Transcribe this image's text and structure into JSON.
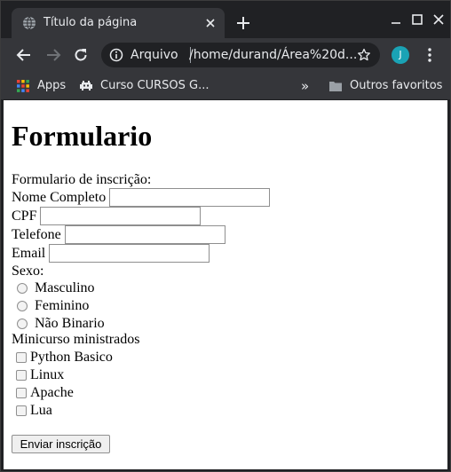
{
  "browser": {
    "tab_title": "Título da página",
    "omnibox_scheme": "Arquivo",
    "omnibox_url": "/home/durand/Área%20d...",
    "avatar_letter": "J",
    "bookmarks": {
      "apps_label": "Apps",
      "course_label": "Curso CURSOS G...",
      "overflow_label": "»",
      "other_label": "Outros favoritos"
    },
    "colors": {
      "frame": "#202124",
      "toolbar": "#35363a",
      "avatar": "#1aa3b5"
    }
  },
  "page": {
    "title": "Formulario",
    "form_intro": "Formulario de inscrição:",
    "fields": [
      {
        "label": "Nome Completo",
        "value": ""
      },
      {
        "label": "CPF",
        "value": ""
      },
      {
        "label": "Telefone",
        "value": ""
      },
      {
        "label": "Email",
        "value": ""
      }
    ],
    "sex_label": "Sexo:",
    "sex_options": [
      "Masculino",
      "Feminino",
      "Não Binario"
    ],
    "courses_label": "Minicurso ministrados",
    "course_options": [
      "Python Basico",
      "Linux",
      "Apache",
      "Lua"
    ],
    "submit_label": "Enviar inscrição"
  }
}
